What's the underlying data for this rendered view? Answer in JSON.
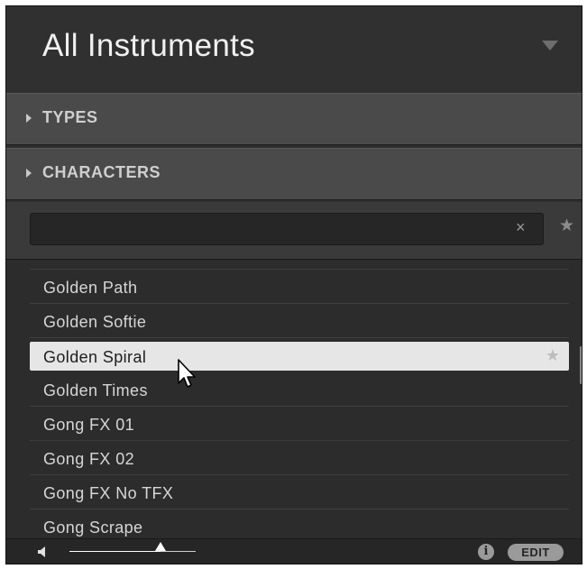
{
  "header": {
    "title": "All Instruments"
  },
  "sections": [
    {
      "label": "TYPES"
    },
    {
      "label": "CHARACTERS"
    }
  ],
  "search": {
    "value": "",
    "placeholder": "",
    "clear_glyph": "×",
    "favorites_glyph": "★"
  },
  "list": {
    "items": [
      {
        "name": "Golden Path",
        "selected": false
      },
      {
        "name": "Golden Softie",
        "selected": false
      },
      {
        "name": "Golden Spiral",
        "selected": true,
        "star_glyph": "★"
      },
      {
        "name": "Golden Times",
        "selected": false
      },
      {
        "name": "Gong FX 01",
        "selected": false
      },
      {
        "name": "Gong FX 02",
        "selected": false
      },
      {
        "name": "Gong FX No TFX",
        "selected": false
      },
      {
        "name": "Gong Scrape",
        "selected": false
      }
    ]
  },
  "footer": {
    "volume_fraction": 0.72,
    "info_glyph": "i",
    "edit_label": "EDIT"
  },
  "icons": {
    "dropdown": "chevron-down-icon",
    "section_arrow": "triangle-right-icon",
    "clear": "close-icon",
    "favorites": "star-icon",
    "speaker": "speaker-icon",
    "info": "info-icon",
    "cursor": "mouse-pointer-icon"
  },
  "colors": {
    "panel_bg": "#2e2e2e",
    "section_bg": "#4a4a4a",
    "selected_row_bg": "#e6e6e6",
    "text": "#d6d6d6"
  }
}
